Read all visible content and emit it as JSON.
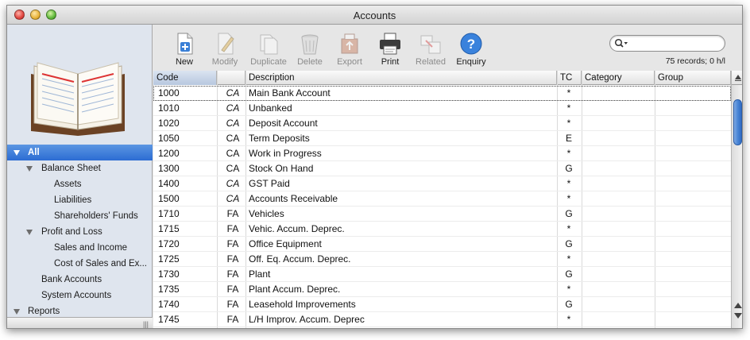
{
  "window": {
    "title": "Accounts"
  },
  "sidebar": {
    "items": [
      {
        "label": "All",
        "level": 0,
        "expanded": true,
        "selected": true
      },
      {
        "label": "Balance Sheet",
        "level": 1,
        "expanded": true
      },
      {
        "label": "Assets",
        "level": 2
      },
      {
        "label": "Liabilities",
        "level": 2
      },
      {
        "label": "Shareholders' Funds",
        "level": 2
      },
      {
        "label": "Profit and Loss",
        "level": 1,
        "expanded": true
      },
      {
        "label": "Sales and Income",
        "level": 2
      },
      {
        "label": "Cost of Sales and Ex...",
        "level": 2
      },
      {
        "label": "Bank Accounts",
        "level": 1
      },
      {
        "label": "System Accounts",
        "level": 1
      },
      {
        "label": "Reports",
        "level": 0,
        "expanded": true
      }
    ],
    "footer_grip": "|||"
  },
  "toolbar": {
    "new_label": "New",
    "modify_label": "Modify",
    "duplicate_label": "Duplicate",
    "delete_label": "Delete",
    "export_label": "Export",
    "print_label": "Print",
    "related_label": "Related",
    "enquiry_label": "Enquiry"
  },
  "search": {
    "value": "",
    "placeholder": ""
  },
  "status": {
    "records": "75 records; 0 h/l"
  },
  "table": {
    "columns": {
      "code": "Code",
      "type": "",
      "description": "Description",
      "tc": "TC",
      "category": "Category",
      "group": "Group"
    },
    "rows": [
      {
        "code": "1000",
        "type": "CA",
        "italic": true,
        "description": "Main Bank Account",
        "tc": "*"
      },
      {
        "code": "1010",
        "type": "CA",
        "italic": true,
        "description": "Unbanked",
        "tc": "*"
      },
      {
        "code": "1020",
        "type": "CA",
        "italic": true,
        "description": "Deposit Account",
        "tc": "*"
      },
      {
        "code": "1050",
        "type": "CA",
        "italic": false,
        "description": "Term Deposits",
        "tc": "E"
      },
      {
        "code": "1200",
        "type": "CA",
        "italic": false,
        "description": "Work in Progress",
        "tc": "*"
      },
      {
        "code": "1300",
        "type": "CA",
        "italic": false,
        "description": "Stock On Hand",
        "tc": "G"
      },
      {
        "code": "1400",
        "type": "CA",
        "italic": true,
        "description": "GST Paid",
        "tc": "*"
      },
      {
        "code": "1500",
        "type": "CA",
        "italic": true,
        "description": "Accounts Receivable",
        "tc": "*"
      },
      {
        "code": "1710",
        "type": "FA",
        "italic": false,
        "description": "Vehicles",
        "tc": "G"
      },
      {
        "code": "1715",
        "type": "FA",
        "italic": false,
        "description": "Vehic. Accum. Deprec.",
        "tc": "*"
      },
      {
        "code": "1720",
        "type": "FA",
        "italic": false,
        "description": "Office Equipment",
        "tc": "G"
      },
      {
        "code": "1725",
        "type": "FA",
        "italic": false,
        "description": "Off. Eq. Accum. Deprec.",
        "tc": "*"
      },
      {
        "code": "1730",
        "type": "FA",
        "italic": false,
        "description": "Plant",
        "tc": "G"
      },
      {
        "code": "1735",
        "type": "FA",
        "italic": false,
        "description": "Plant Accum. Deprec.",
        "tc": "*"
      },
      {
        "code": "1740",
        "type": "FA",
        "italic": false,
        "description": "Leasehold Improvements",
        "tc": "G"
      },
      {
        "code": "1745",
        "type": "FA",
        "italic": false,
        "description": "L/H Improv. Accum. Deprec",
        "tc": "*"
      }
    ]
  },
  "colors": {
    "selection": "#2c6cd3",
    "sidebar_bg": "#dfe5ee",
    "accent": "#4a86d6"
  },
  "icons": [
    "book-icon",
    "new-icon",
    "modify-icon",
    "duplicate-icon",
    "delete-icon",
    "export-icon",
    "print-icon",
    "related-icon",
    "enquiry-icon",
    "search-icon"
  ]
}
